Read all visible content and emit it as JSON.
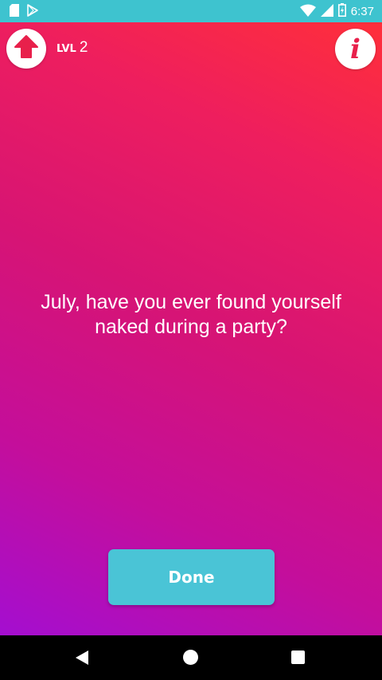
{
  "status_bar": {
    "time": "6:37",
    "icons": [
      "sd-card-icon",
      "play-store-icon",
      "wifi-icon",
      "signal-icon",
      "battery-icon"
    ],
    "color": "#3ec3cf"
  },
  "header": {
    "level_label": "LVL",
    "level_value": "2",
    "up_icon": "arrow-up-icon",
    "info_glyph": "i",
    "accent_color": "#e8204b"
  },
  "main": {
    "question": "July, have you ever found yourself naked during a party?"
  },
  "actions": {
    "done_label": "Done",
    "done_color": "#4ac4d6"
  },
  "nav_bar": {
    "icons": [
      "back-icon",
      "home-icon",
      "recents-icon"
    ]
  }
}
